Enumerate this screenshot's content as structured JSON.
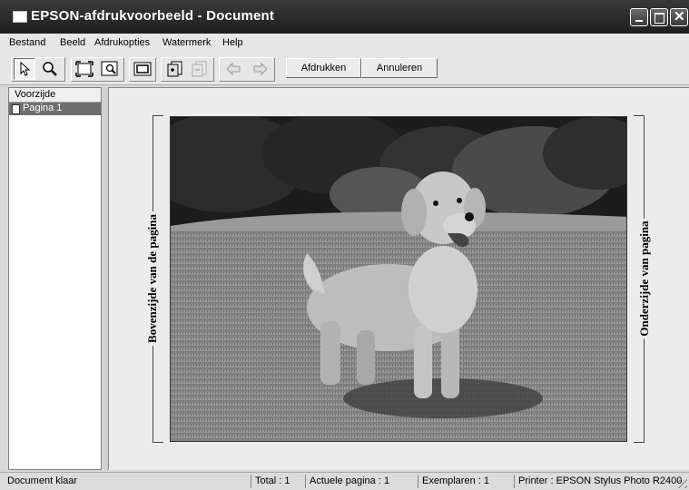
{
  "window": {
    "title": "EPSON-afdrukvoorbeeld - Document",
    "controls": [
      "minimize-icon",
      "maximize-icon",
      "close-icon"
    ]
  },
  "menu": {
    "items": [
      {
        "label": "Bestand"
      },
      {
        "label": "Beeld"
      },
      {
        "label": "Afdrukopties"
      },
      {
        "label": "Watermerk"
      },
      {
        "label": "Help"
      }
    ]
  },
  "toolbar": {
    "icons": [
      "pointer-icon",
      "zoom-icon",
      "fit-page-icon",
      "zoom-window-icon",
      "printable-area-icon",
      "add-page-icon",
      "remove-page-icon",
      "back-arrow-icon",
      "forward-arrow-icon"
    ],
    "print_label": "Afdrukken",
    "cancel_label": "Annuleren"
  },
  "left_panel": {
    "header": "Voorzijde",
    "pages": [
      {
        "label": "Pagina 1",
        "selected": true
      }
    ]
  },
  "preview": {
    "left_label": "Bovenzijde van de pagina",
    "right_label": "Onderzijde van pagina"
  },
  "statusbar": {
    "status": "Document klaar",
    "total": "Total : 1",
    "current_page": "Actuele pagina : 1",
    "copies": "Exemplaren : 1",
    "printer": "Printer : EPSON Stylus Photo R2400"
  }
}
